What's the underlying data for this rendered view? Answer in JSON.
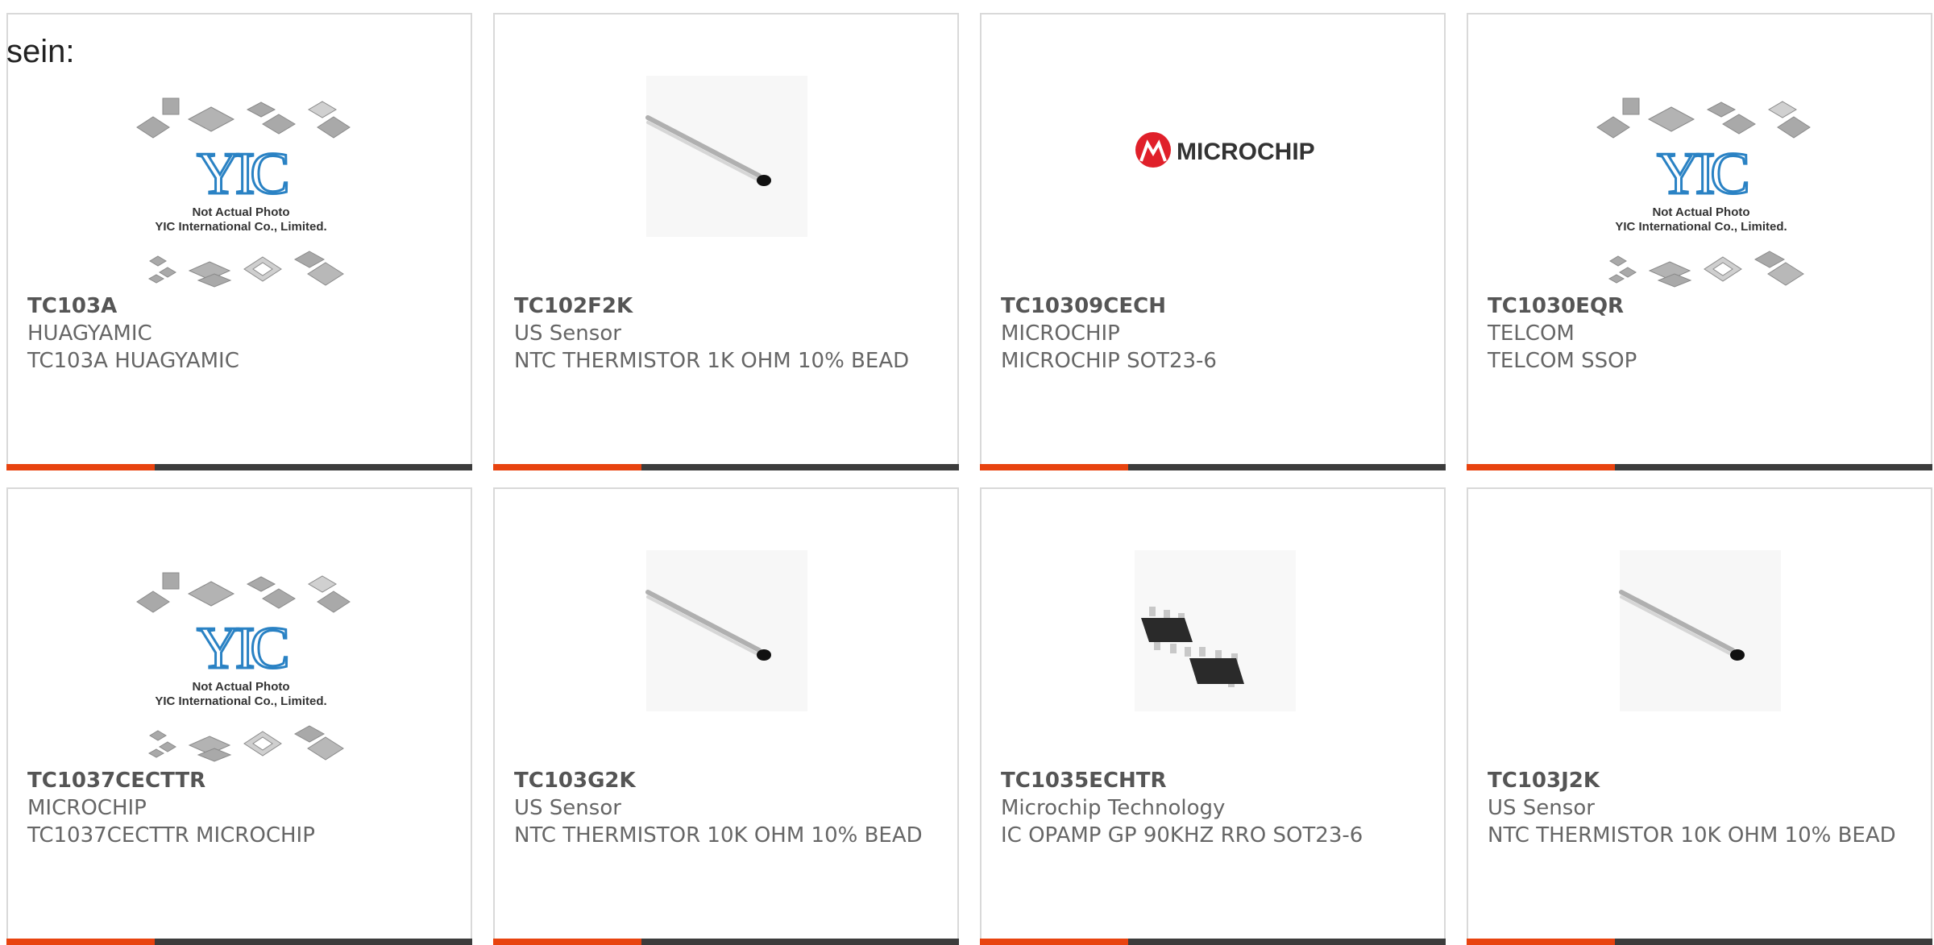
{
  "page_label": "sein:",
  "placeholder_image": {
    "line1": "Not Actual Photo",
    "line2": "YIC International Co., Limited."
  },
  "microchip_logo_text": "MICROCHIP",
  "colors": {
    "accent": "#e8430f",
    "bar": "#3c3c3c",
    "border": "#d9d9d9",
    "text": "#666666",
    "yic_blue": "#2a82c4",
    "microchip_red": "#e0202a"
  },
  "products": [
    {
      "part_number": "TC103A",
      "manufacturer": "HUAGYAMIC",
      "description": "TC103A HUAGYAMIC",
      "image": "yic-placeholder"
    },
    {
      "part_number": "TC102F2K",
      "manufacturer": "US Sensor",
      "description": "NTC THERMISTOR 1K OHM 10% BEAD",
      "image": "thermistor"
    },
    {
      "part_number": "TC10309CECH",
      "manufacturer": "MICROCHIP",
      "description": "MICROCHIP SOT23-6",
      "image": "microchip-logo"
    },
    {
      "part_number": "TC1030EQR",
      "manufacturer": "TELCOM",
      "description": "TELCOM SSOP",
      "image": "yic-placeholder"
    },
    {
      "part_number": "TC1037CECTTR",
      "manufacturer": "MICROCHIP",
      "description": "TC1037CECTTR MICROCHIP",
      "image": "yic-placeholder"
    },
    {
      "part_number": "TC103G2K",
      "manufacturer": "US Sensor",
      "description": "NTC THERMISTOR 10K OHM 10% BEAD",
      "image": "thermistor"
    },
    {
      "part_number": "TC1035ECHTR",
      "manufacturer": "Microchip Technology",
      "description": "IC OPAMP GP 90KHZ RRO SOT23-6",
      "image": "sot23-chip"
    },
    {
      "part_number": "TC103J2K",
      "manufacturer": "US Sensor",
      "description": "NTC THERMISTOR 10K OHM 10% BEAD",
      "image": "thermistor"
    }
  ]
}
